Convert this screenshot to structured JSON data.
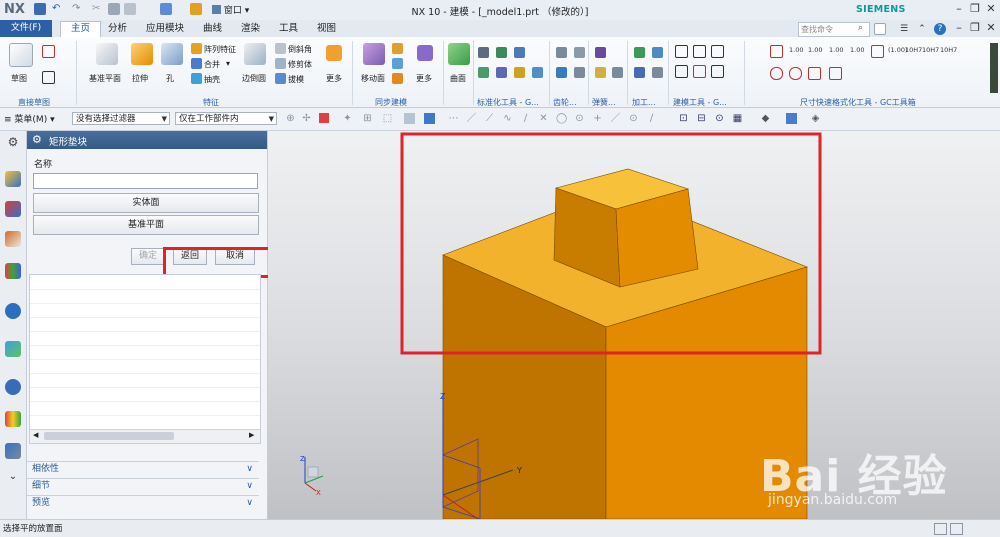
{
  "titlebar": {
    "logo": "NX",
    "title": "NX 10 - 建模 - [_model1.prt （修改的）]",
    "window_menu": "窗口",
    "brand": "SIEMENS"
  },
  "tabs": {
    "file": "文件(F)",
    "items": [
      "主页",
      "分析",
      "应用模块",
      "曲线",
      "渲染",
      "工具",
      "视图"
    ],
    "search_placeholder": "查找命令"
  },
  "ribbon": {
    "groups": {
      "sketch": "直接草图",
      "feature": "特征",
      "sync": "同步建模",
      "std": "标准化工具 - G...",
      "gear": "齿轮...",
      "spring": "弹簧...",
      "machining": "加工...",
      "build": "建模工具 - G...",
      "dim": "尺寸快速格式化工具 - GC工具箱"
    },
    "buttons": {
      "sketch": "草图",
      "datum_plane": "基准平面",
      "extrude": "拉伸",
      "hole": "孔",
      "pattern": "阵列特征",
      "unite": "合并",
      "shell": "抽壳",
      "edge_blend": "边倒圆",
      "chamfer": "倒斜角",
      "trim_body": "修剪体",
      "draft": "拔模",
      "more1": "更多",
      "move_face": "移动面",
      "more2": "更多",
      "surface": "曲面"
    },
    "dim_labels": [
      "1.00",
      "1.00",
      "1.00",
      "1.00",
      "(1.00)",
      "10H7",
      "10H7",
      "10H7"
    ]
  },
  "toolbar2": {
    "menu": "菜单(M)",
    "filter": "没有选择过滤器",
    "scope": "仅在工作部件内"
  },
  "dialog": {
    "title": "矩形垫块",
    "name_label": "名称",
    "name_value": "",
    "solid_face": "实体面",
    "datum_plane": "基准平面",
    "ok": "确定",
    "back": "返回",
    "cancel": "取消",
    "sections": [
      "相依性",
      "细节",
      "预览"
    ]
  },
  "viewport": {
    "axis_z": "Z",
    "axis_y": "Y",
    "axis_x": "X",
    "colors": {
      "top": "#f3b22b",
      "front": "#e38a00",
      "side": "#c07400",
      "highlight": "#e0222a"
    }
  },
  "status": {
    "text": "选择平的放置面"
  },
  "watermark": {
    "brand": "Bai 经验",
    "url": "jingyan.baidu.com"
  }
}
